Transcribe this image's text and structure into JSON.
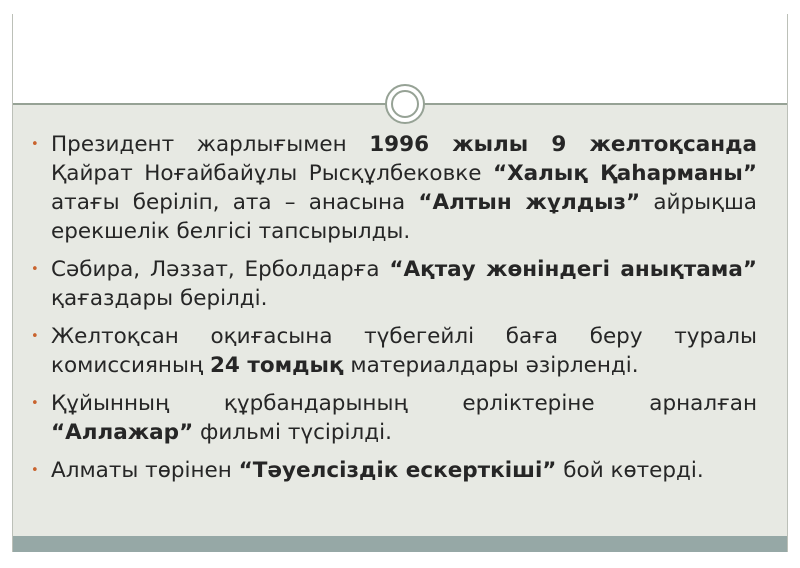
{
  "bullets": [
    {
      "parts": [
        {
          "text": "Президент жарлығымен ",
          "bold": false
        },
        {
          "text": "1996 жылы 9 желтоқсанда",
          "bold": true
        },
        {
          "text": " Қайрат Ноғайбайұлы Рысқұлбековке ",
          "bold": false
        },
        {
          "text": "“Халық Қаһарманы”",
          "bold": true
        },
        {
          "text": " атағы беріліп, ата – анасына ",
          "bold": false
        },
        {
          "text": "“Алтын жұлдыз”",
          "bold": true
        },
        {
          "text": " айрықша ерекшелік белгісі тапсырылды.",
          "bold": false
        }
      ]
    },
    {
      "parts": [
        {
          "text": "Сәбира, Ләззат, Ерболдарға ",
          "bold": false
        },
        {
          "text": "“Ақтау жөніндегі анықтама”",
          "bold": true
        },
        {
          "text": " қағаздары берілді.",
          "bold": false
        }
      ]
    },
    {
      "parts": [
        {
          "text": "Желтоқсан оқиғасына түбегейлі баға беру туралы комиссияның ",
          "bold": false
        },
        {
          "text": "24 томдық",
          "bold": true
        },
        {
          "text": " материалдары әзірленді.",
          "bold": false
        }
      ]
    },
    {
      "parts": [
        {
          "text": "Құйынның құрбандарының ерліктеріне арналған ",
          "bold": false
        },
        {
          "text": "“Аллажар”",
          "bold": true
        },
        {
          "text": " фильмі түсірілді.",
          "bold": false
        }
      ]
    },
    {
      "parts": [
        {
          "text": "Алматы төрінен ",
          "bold": false
        },
        {
          "text": "“Тәуелсіздік ескерткіші”",
          "bold": true
        },
        {
          "text": " бой көтерді.",
          "bold": false
        }
      ]
    }
  ],
  "bullet_symbol": "•",
  "colors": {
    "background": "#e7e9e3",
    "accent_line": "#96a295",
    "bullet": "#c9642f",
    "text": "#262626",
    "bottom_band": "#96a8a6"
  },
  "icons": {
    "divider_ornament": "double-circle-icon"
  }
}
